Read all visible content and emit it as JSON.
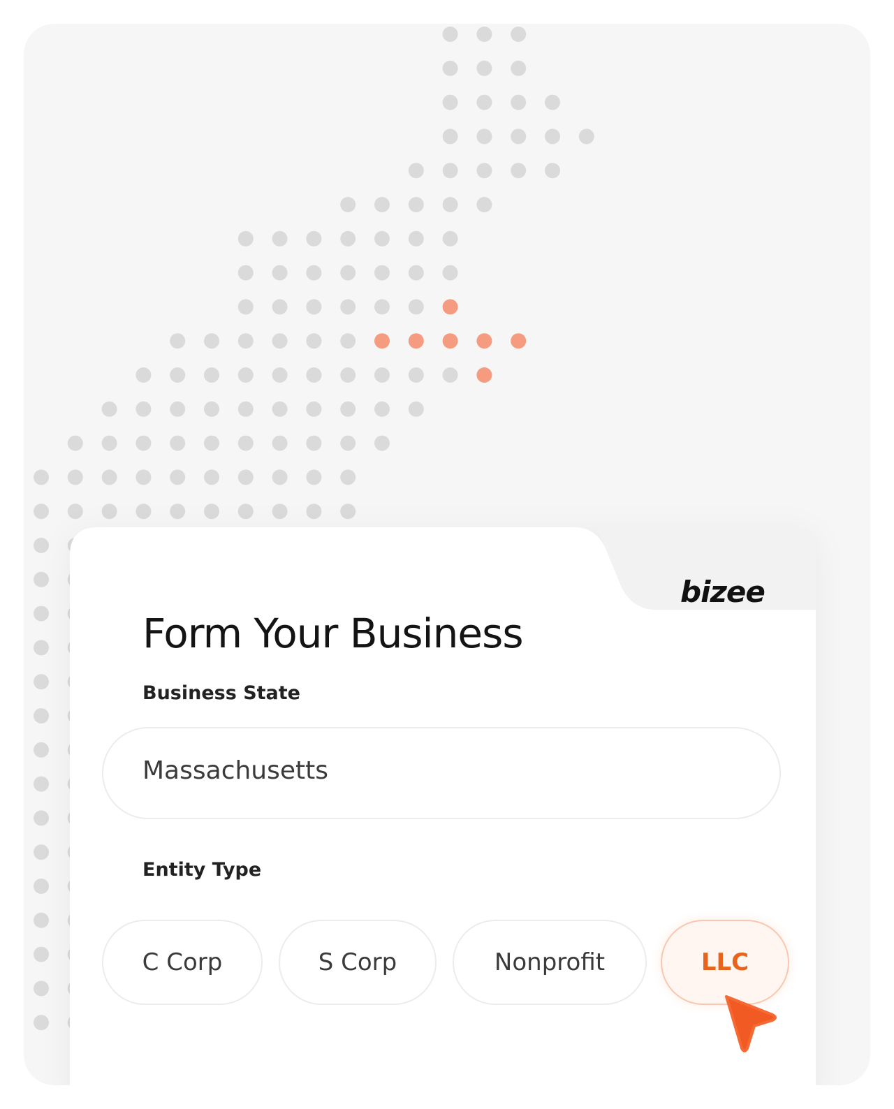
{
  "colors": {
    "accent": "#f15a22",
    "dot_gray": "#dadada",
    "dot_highlight": "#f49b80",
    "card_bg": "#ffffff",
    "page_bg": "#f6f6f6"
  },
  "map": {
    "highlighted_state": "Massachusetts"
  },
  "brand": {
    "logo_text": "bizee"
  },
  "form": {
    "title": "Form Your Business",
    "state_label": "Business State",
    "state_value": "Massachusetts",
    "entity_label": "Entity Type",
    "entity_options": [
      "C Corp",
      "S Corp",
      "Nonprofit",
      "LLC"
    ],
    "selected_entity": "LLC"
  },
  "icons": {
    "cursor": "pointer-cursor-icon"
  }
}
